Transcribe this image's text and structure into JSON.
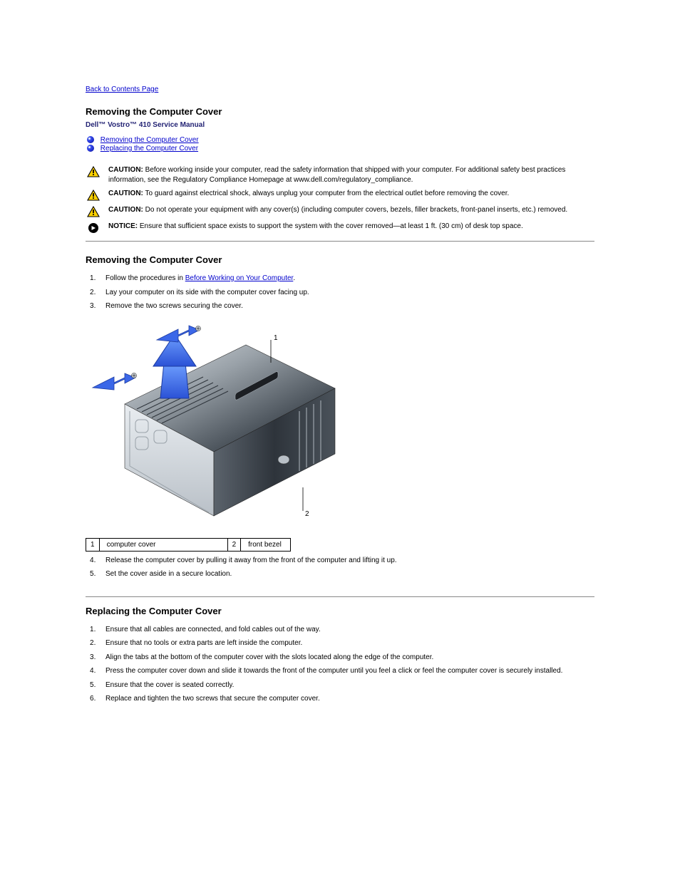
{
  "nav": {
    "back_label": "Back to Contents Page"
  },
  "header": {
    "page_title": "Removing the Computer Cover",
    "doc_title": "Dell™ Vostro™ 410 Service Manual"
  },
  "toc": {
    "items": [
      {
        "label": "Removing the Computer Cover"
      },
      {
        "label": "Replacing the Computer Cover"
      }
    ]
  },
  "notices": [
    {
      "kind": "caution",
      "lead": "CAUTION:",
      "text": " Before working inside your computer, read the safety information that shipped with your computer. For additional safety best practices information, see the Regulatory Compliance Homepage at www.dell.com/regulatory_compliance."
    },
    {
      "kind": "caution",
      "lead": "CAUTION:",
      "text": " To guard against electrical shock, always unplug your computer from the electrical outlet before removing the cover."
    },
    {
      "kind": "caution",
      "lead": "CAUTION:",
      "text": " Do not operate your equipment with any cover(s) (including computer covers, bezels, filler brackets, front-panel inserts, etc.) removed."
    },
    {
      "kind": "notice",
      "lead": "NOTICE:",
      "text": " Ensure that sufficient space exists to support the system with the cover removed—at least 1 ft. (30 cm) of desk top space."
    }
  ],
  "remove": {
    "heading": "Removing the Computer Cover",
    "steps": [
      {
        "text_before": "Follow the procedures in ",
        "link": "Before Working on Your Computer",
        "text_after": "."
      },
      {
        "text": "Lay your computer on its side with the computer cover facing up."
      },
      {
        "text": "Remove the two screws securing the cover."
      }
    ],
    "legend": [
      {
        "n": "1",
        "label": "computer cover"
      },
      {
        "n": "2",
        "label": "front bezel"
      }
    ],
    "steps_cont": [
      {
        "n": "4",
        "text": "Release the computer cover by pulling it away from the front of the computer and lifting it up."
      },
      {
        "n": "5",
        "text": "Set the cover aside in a secure location."
      }
    ]
  },
  "replace": {
    "heading": "Replacing the Computer Cover",
    "steps": [
      {
        "text": "Ensure that all cables are connected, and fold cables out of the way."
      },
      {
        "text": "Ensure that no tools or extra parts are left inside the computer."
      },
      {
        "text": "Align the tabs at the bottom of the computer cover with the slots located along the edge of the computer."
      },
      {
        "text": "Press the computer cover down and slide it towards the front of the computer until you feel a click or feel the computer cover is securely installed."
      },
      {
        "text": "Ensure that the cover is seated correctly."
      },
      {
        "text": "Replace and tighten the two screws that secure the computer cover."
      }
    ]
  }
}
